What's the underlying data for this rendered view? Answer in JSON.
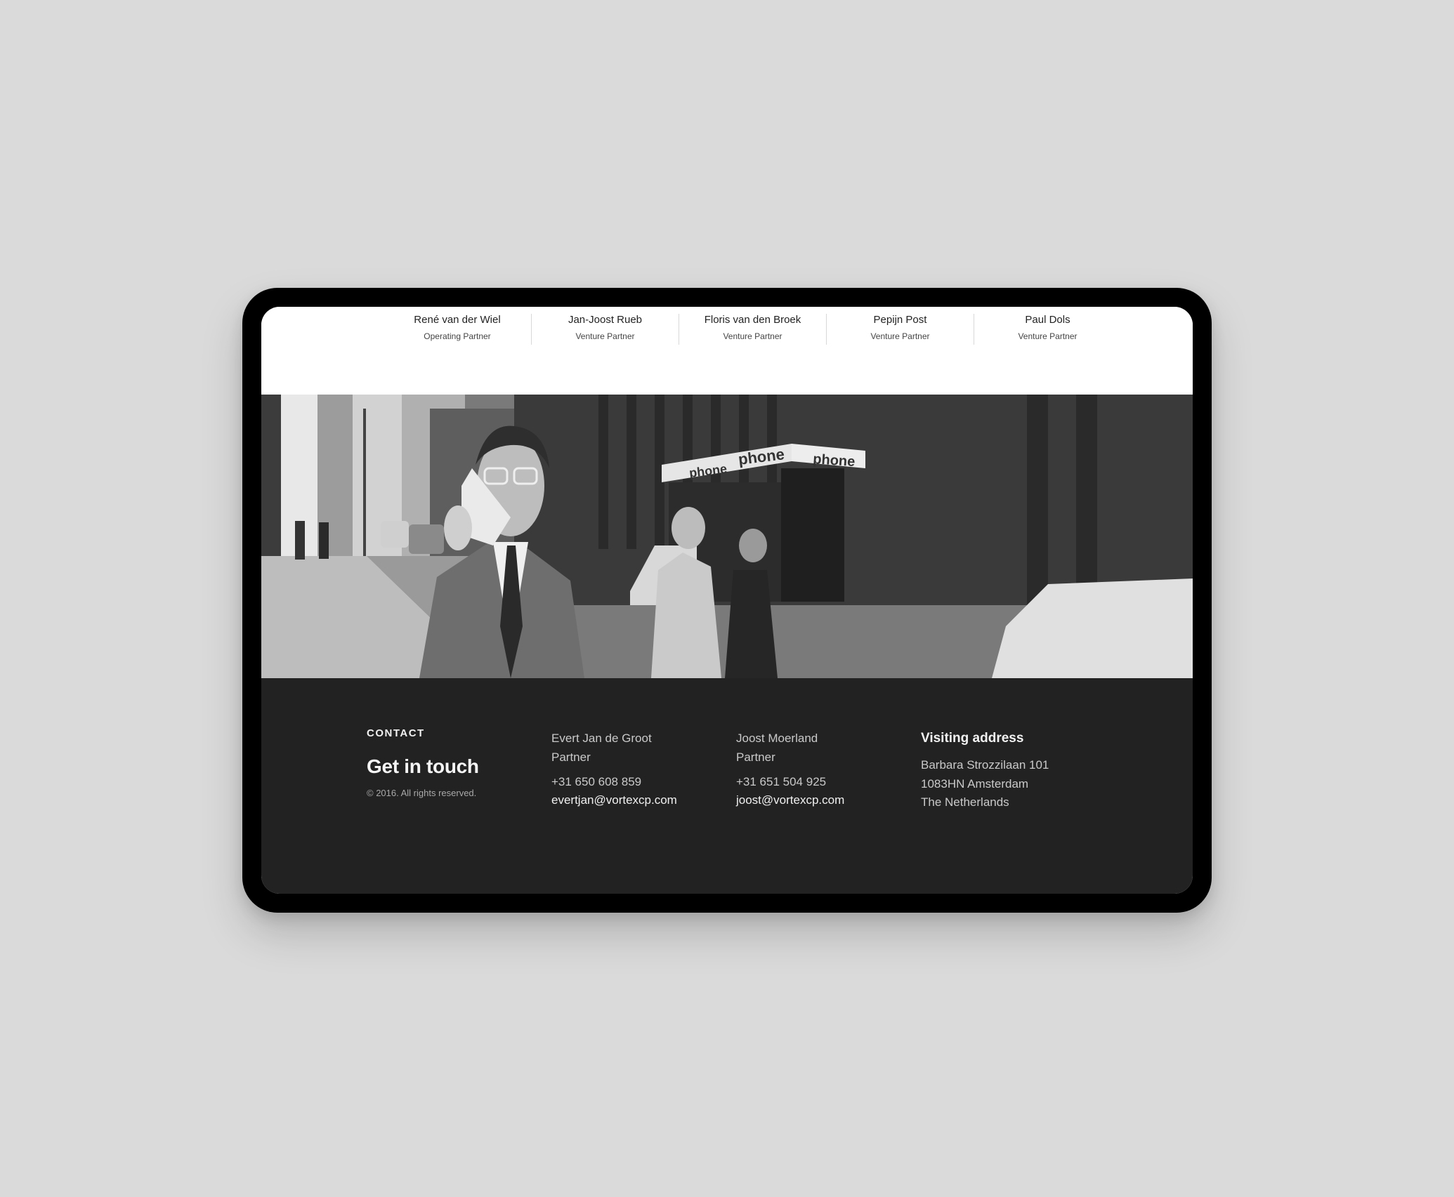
{
  "team": [
    {
      "name": "René van der Wiel",
      "role": "Operating Partner"
    },
    {
      "name": "Jan-Joost Rueb",
      "role": "Venture Partner"
    },
    {
      "name": "Floris van den Broek",
      "role": "Venture Partner"
    },
    {
      "name": "Pepijn Post",
      "role": "Venture Partner"
    },
    {
      "name": "Paul Dols",
      "role": "Venture Partner"
    }
  ],
  "hero": {
    "description": "Black-and-white street photo of a man in a suit holding a brick mobile phone beside phone booths",
    "booth_signs": [
      "phone",
      "phone",
      "phone"
    ]
  },
  "footer": {
    "eyebrow": "CONTACT",
    "headline": "Get in touch",
    "copyright": "© 2016. All rights reserved.",
    "contacts": [
      {
        "name": "Evert Jan de Groot",
        "role": "Partner",
        "phone": "+31 650 608 859",
        "email": "evertjan@vortexcp.com"
      },
      {
        "name": "Joost Moerland",
        "role": "Partner",
        "phone": "+31 651 504 925",
        "email": "joost@vortexcp.com"
      }
    ],
    "address": {
      "title": "Visiting address",
      "lines": [
        "Barbara Strozzilaan 101",
        "1083HN Amsterdam",
        "The Netherlands"
      ]
    }
  },
  "colors": {
    "page_background": "#dadada",
    "device_frame": "#000000",
    "footer_background": "#222222",
    "team_background": "#ffffff"
  }
}
